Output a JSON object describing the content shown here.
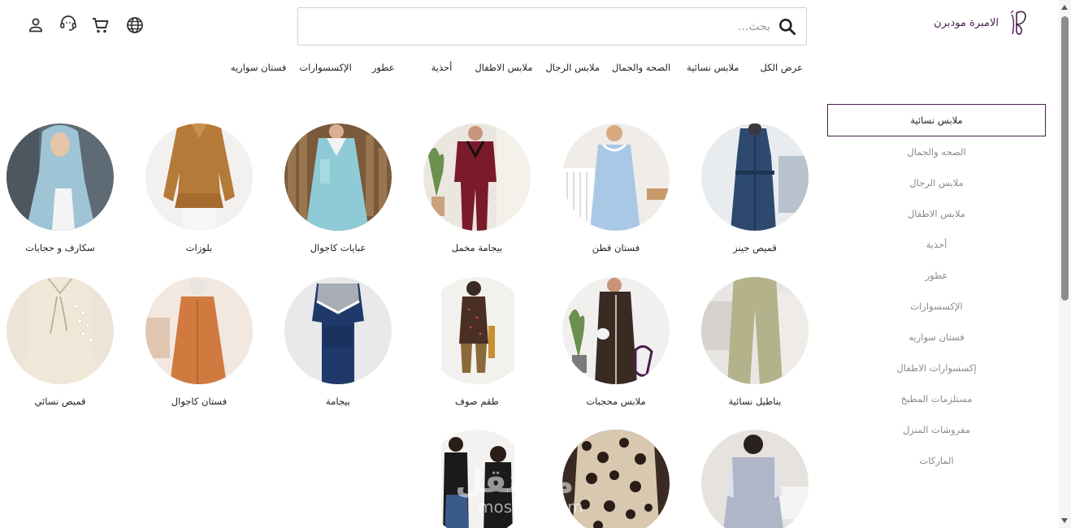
{
  "brand": {
    "name": "الامبرة مودبرن"
  },
  "search": {
    "placeholder": "بحث..."
  },
  "header_icons": [
    "account-icon",
    "support-icon",
    "cart-icon",
    "language-icon"
  ],
  "nav": [
    "عرض الكل",
    "ملابس نسائية",
    "الصحه والجمال",
    "ملابس الرجال",
    "ملابس الاطفال",
    "أحذية",
    "عطور",
    "الإكسسوارات",
    "فستان سواريه"
  ],
  "sidebar": [
    "ملابس نسائية",
    "الصحه والجمال",
    "ملابس الرجال",
    "ملابس الاطفال",
    "أحذية",
    "عطور",
    "الإكسسوارات",
    "فستان سواريه",
    "إكسسوارات الاطفال",
    "مستلزمات المطبخ",
    "مفروشات المنزل",
    "الماركات"
  ],
  "categories": [
    "قميص جينز",
    "فستان قطن",
    "بيجامة مخمل",
    "عبايات كاجوال",
    "بلوزات",
    "سكارف و حجابات",
    "بناطيل نسائية",
    "ملابس محجبات",
    "طقم صوف",
    "بيجامة",
    "فستان كاجوال",
    "قميص نسائي",
    "",
    "",
    ""
  ],
  "watermark": {
    "line1": "مستقل",
    "line2": "mostaql.com"
  },
  "colors": {
    "brand": "#4a1e4e",
    "active_border": "#4a1e4e"
  }
}
